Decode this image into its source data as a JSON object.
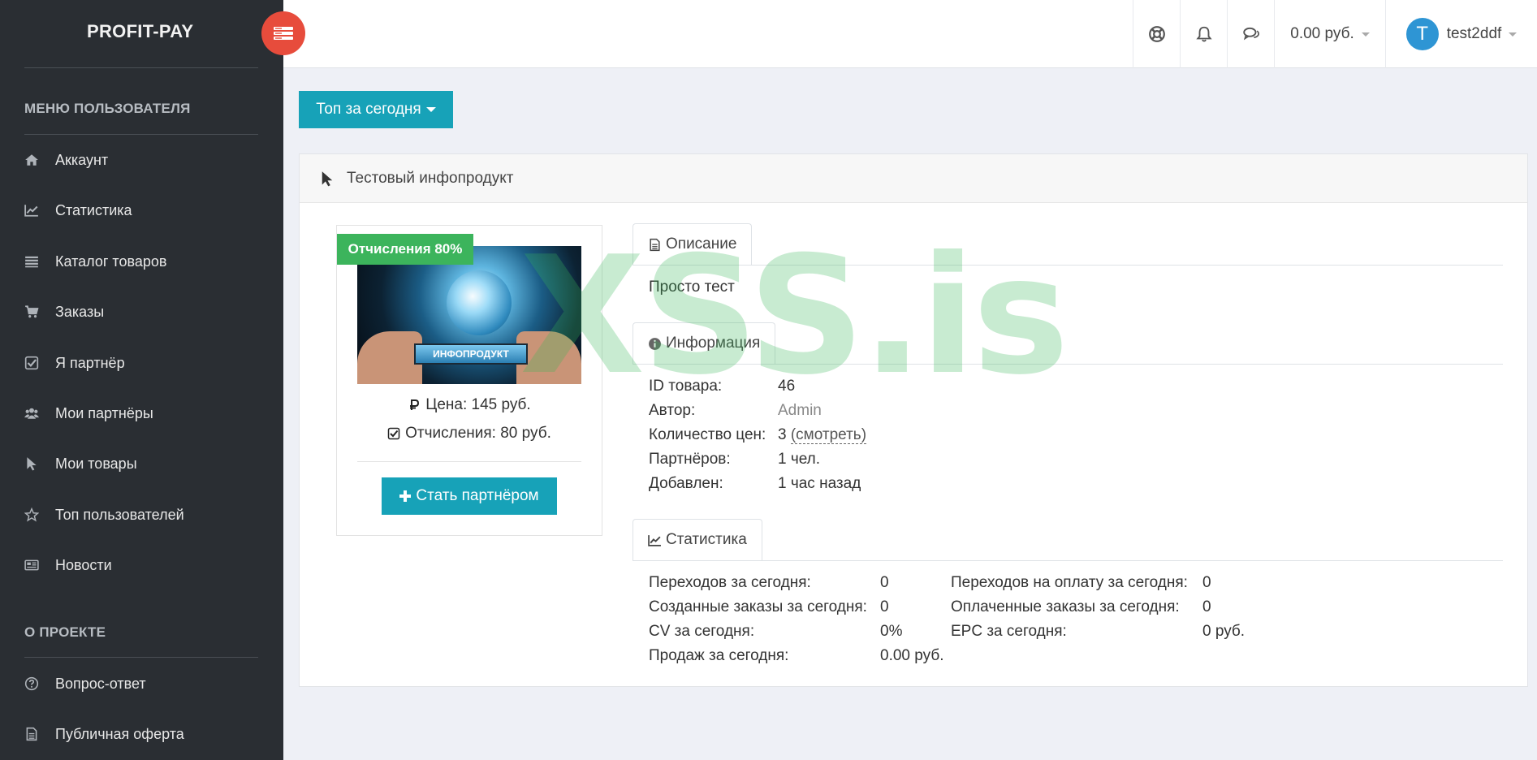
{
  "brand": {
    "name": "PROFIT-PAY"
  },
  "sidebar": {
    "section_user": "МЕНЮ ПОЛЬЗОВАТЕЛЯ",
    "items": [
      {
        "label": "Аккаунт",
        "icon": "home-icon"
      },
      {
        "label": "Статистика",
        "icon": "line-chart-icon"
      },
      {
        "label": "Каталог товаров",
        "icon": "list-icon"
      },
      {
        "label": "Заказы",
        "icon": "cart-icon"
      },
      {
        "label": "Я партнёр",
        "icon": "check-square-icon"
      },
      {
        "label": "Мои партнёры",
        "icon": "users-icon"
      },
      {
        "label": "Мои товары",
        "icon": "pointer-icon"
      },
      {
        "label": "Топ пользователей",
        "icon": "star-icon"
      },
      {
        "label": "Новости",
        "icon": "newspaper-icon"
      }
    ],
    "section_project": "О ПРОЕКТЕ",
    "project_items": [
      {
        "label": "Вопрос-ответ",
        "icon": "question-circle-icon"
      },
      {
        "label": "Публичная оферта",
        "icon": "document-icon"
      }
    ]
  },
  "topbar": {
    "balance": "0.00 руб.",
    "avatar_letter": "T",
    "username": "test2ddf"
  },
  "toolbar": {
    "top_button": "Топ за сегодня"
  },
  "product": {
    "title": "Тестовый инфопродукт",
    "badge": "Отчисления 80%",
    "image_caption": "ИНФОПРОДУКТ",
    "price": "Цена: 145 руб.",
    "commission": "Отчисления: 80 руб.",
    "partner_button": "Стать партнёром"
  },
  "tabs": {
    "description": "Описание",
    "info": "Информация",
    "stats": "Статистика"
  },
  "description_text": "Просто тест",
  "info": {
    "id_label": "ID товара:",
    "id_value": "46",
    "author_label": "Автор:",
    "author_value": "Admin",
    "prices_label": "Количество цен:",
    "prices_value": "3",
    "prices_link": "(смотреть)",
    "partners_label": "Партнёров:",
    "partners_value": "1 чел.",
    "added_label": "Добавлен:",
    "added_value": "1 час назад"
  },
  "stats": {
    "left": [
      {
        "label": "Переходов за сегодня:",
        "value": "0"
      },
      {
        "label": "Созданные заказы за сегодня:",
        "value": "0"
      },
      {
        "label": "CV за сегодня:",
        "value": "0%"
      },
      {
        "label": "Продаж за сегодня:",
        "value": "0.00 руб."
      }
    ],
    "right": [
      {
        "label": "Переходов на оплату за сегодня:",
        "value": "0"
      },
      {
        "label": "Оплаченные заказы за сегодня:",
        "value": "0"
      },
      {
        "label": "EPC за сегодня:",
        "value": "0 руб."
      }
    ]
  },
  "watermark": "XSS.is",
  "colors": {
    "sidebar": "#2a2e33",
    "accent": "#17a2b8",
    "toggle": "#e74c3c",
    "badge": "#3cb45c",
    "avatar": "#2e95d4"
  }
}
